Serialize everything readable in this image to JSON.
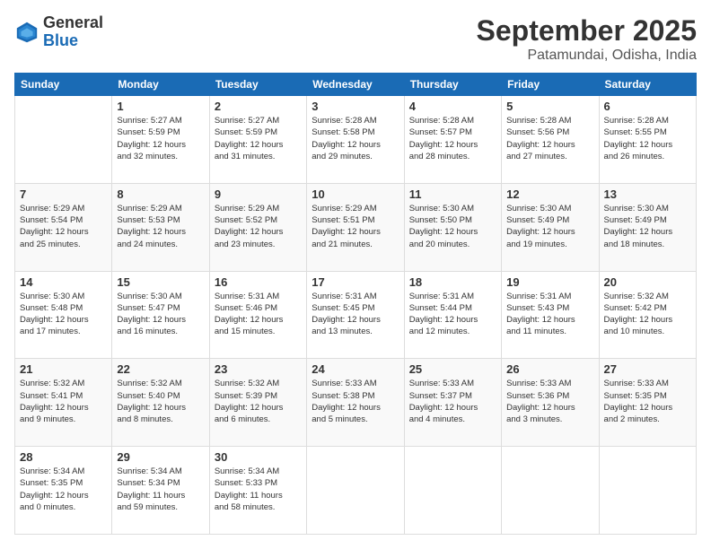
{
  "header": {
    "logo_general": "General",
    "logo_blue": "Blue",
    "month_title": "September 2025",
    "location": "Patamundai, Odisha, India"
  },
  "columns": [
    "Sunday",
    "Monday",
    "Tuesday",
    "Wednesday",
    "Thursday",
    "Friday",
    "Saturday"
  ],
  "weeks": [
    [
      {
        "day": "",
        "info": ""
      },
      {
        "day": "1",
        "info": "Sunrise: 5:27 AM\nSunset: 5:59 PM\nDaylight: 12 hours\nand 32 minutes."
      },
      {
        "day": "2",
        "info": "Sunrise: 5:27 AM\nSunset: 5:59 PM\nDaylight: 12 hours\nand 31 minutes."
      },
      {
        "day": "3",
        "info": "Sunrise: 5:28 AM\nSunset: 5:58 PM\nDaylight: 12 hours\nand 29 minutes."
      },
      {
        "day": "4",
        "info": "Sunrise: 5:28 AM\nSunset: 5:57 PM\nDaylight: 12 hours\nand 28 minutes."
      },
      {
        "day": "5",
        "info": "Sunrise: 5:28 AM\nSunset: 5:56 PM\nDaylight: 12 hours\nand 27 minutes."
      },
      {
        "day": "6",
        "info": "Sunrise: 5:28 AM\nSunset: 5:55 PM\nDaylight: 12 hours\nand 26 minutes."
      }
    ],
    [
      {
        "day": "7",
        "info": "Sunrise: 5:29 AM\nSunset: 5:54 PM\nDaylight: 12 hours\nand 25 minutes."
      },
      {
        "day": "8",
        "info": "Sunrise: 5:29 AM\nSunset: 5:53 PM\nDaylight: 12 hours\nand 24 minutes."
      },
      {
        "day": "9",
        "info": "Sunrise: 5:29 AM\nSunset: 5:52 PM\nDaylight: 12 hours\nand 23 minutes."
      },
      {
        "day": "10",
        "info": "Sunrise: 5:29 AM\nSunset: 5:51 PM\nDaylight: 12 hours\nand 21 minutes."
      },
      {
        "day": "11",
        "info": "Sunrise: 5:30 AM\nSunset: 5:50 PM\nDaylight: 12 hours\nand 20 minutes."
      },
      {
        "day": "12",
        "info": "Sunrise: 5:30 AM\nSunset: 5:49 PM\nDaylight: 12 hours\nand 19 minutes."
      },
      {
        "day": "13",
        "info": "Sunrise: 5:30 AM\nSunset: 5:49 PM\nDaylight: 12 hours\nand 18 minutes."
      }
    ],
    [
      {
        "day": "14",
        "info": "Sunrise: 5:30 AM\nSunset: 5:48 PM\nDaylight: 12 hours\nand 17 minutes."
      },
      {
        "day": "15",
        "info": "Sunrise: 5:30 AM\nSunset: 5:47 PM\nDaylight: 12 hours\nand 16 minutes."
      },
      {
        "day": "16",
        "info": "Sunrise: 5:31 AM\nSunset: 5:46 PM\nDaylight: 12 hours\nand 15 minutes."
      },
      {
        "day": "17",
        "info": "Sunrise: 5:31 AM\nSunset: 5:45 PM\nDaylight: 12 hours\nand 13 minutes."
      },
      {
        "day": "18",
        "info": "Sunrise: 5:31 AM\nSunset: 5:44 PM\nDaylight: 12 hours\nand 12 minutes."
      },
      {
        "day": "19",
        "info": "Sunrise: 5:31 AM\nSunset: 5:43 PM\nDaylight: 12 hours\nand 11 minutes."
      },
      {
        "day": "20",
        "info": "Sunrise: 5:32 AM\nSunset: 5:42 PM\nDaylight: 12 hours\nand 10 minutes."
      }
    ],
    [
      {
        "day": "21",
        "info": "Sunrise: 5:32 AM\nSunset: 5:41 PM\nDaylight: 12 hours\nand 9 minutes."
      },
      {
        "day": "22",
        "info": "Sunrise: 5:32 AM\nSunset: 5:40 PM\nDaylight: 12 hours\nand 8 minutes."
      },
      {
        "day": "23",
        "info": "Sunrise: 5:32 AM\nSunset: 5:39 PM\nDaylight: 12 hours\nand 6 minutes."
      },
      {
        "day": "24",
        "info": "Sunrise: 5:33 AM\nSunset: 5:38 PM\nDaylight: 12 hours\nand 5 minutes."
      },
      {
        "day": "25",
        "info": "Sunrise: 5:33 AM\nSunset: 5:37 PM\nDaylight: 12 hours\nand 4 minutes."
      },
      {
        "day": "26",
        "info": "Sunrise: 5:33 AM\nSunset: 5:36 PM\nDaylight: 12 hours\nand 3 minutes."
      },
      {
        "day": "27",
        "info": "Sunrise: 5:33 AM\nSunset: 5:35 PM\nDaylight: 12 hours\nand 2 minutes."
      }
    ],
    [
      {
        "day": "28",
        "info": "Sunrise: 5:34 AM\nSunset: 5:35 PM\nDaylight: 12 hours\nand 0 minutes."
      },
      {
        "day": "29",
        "info": "Sunrise: 5:34 AM\nSunset: 5:34 PM\nDaylight: 11 hours\nand 59 minutes."
      },
      {
        "day": "30",
        "info": "Sunrise: 5:34 AM\nSunset: 5:33 PM\nDaylight: 11 hours\nand 58 minutes."
      },
      {
        "day": "",
        "info": ""
      },
      {
        "day": "",
        "info": ""
      },
      {
        "day": "",
        "info": ""
      },
      {
        "day": "",
        "info": ""
      }
    ]
  ]
}
